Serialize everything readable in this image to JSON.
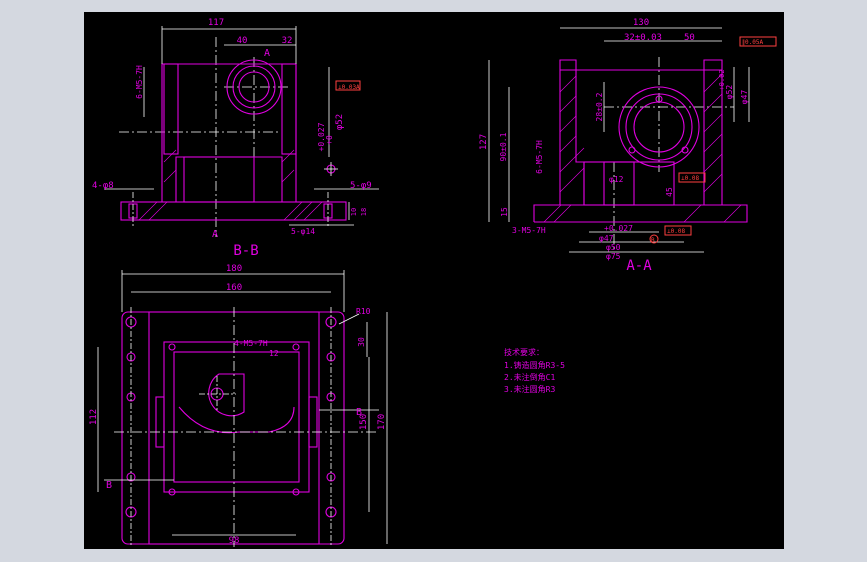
{
  "views": {
    "bb": {
      "title": "B-B",
      "dims": {
        "width_total": "117",
        "d40": "40",
        "d32": "32",
        "thread": "6-M5-7H",
        "bore_tol": "+0.027",
        "bore_tol2": "+0",
        "bore_dia": "φ52",
        "holes_left": "4-φ8",
        "holes_right": "5-φ9",
        "holes_bottom": "5-φ14",
        "h10": "10",
        "h18": "18",
        "flag": "⊥0.03A",
        "section_a": "A"
      }
    },
    "aa": {
      "title": "A-A",
      "dims": {
        "width_total": "130",
        "d32": "32±0.03",
        "d50": "50",
        "flag_top": "∥0.05A",
        "h127": "127",
        "h90": "90±0.1",
        "h28": "28±0.2",
        "thread": "6-M5-7H",
        "d12": "φ12",
        "flag_mid": "⊥0.08",
        "d45": "45",
        "h15": "15",
        "thread_bottom": "3-M5-7H",
        "bore_tol": "+0.027",
        "d47": "φ47",
        "d50b": "φ50",
        "d75": "φ75",
        "flag_bottom": "⊥0.08",
        "d47r": "φ47",
        "d52r": "φ52",
        "tol_r": "+0.02",
        "datum": "B"
      }
    },
    "top": {
      "dims": {
        "w180": "180",
        "w160": "160",
        "r10": "R10",
        "thread": "4-M5-7H",
        "d12": "12",
        "d30": "30",
        "h112": "112",
        "h150": "150",
        "h170": "170",
        "w98": "98",
        "sec_b_left": "B",
        "sec_b_right": "B"
      }
    }
  },
  "notes": {
    "title": "技术要求：",
    "items": [
      "1.铸造圆角R3-5",
      "2.未注倒角C1",
      "3.未注圆角R3"
    ]
  },
  "colors": {
    "line": "#e000e0",
    "center": "#ffffff",
    "annotation": "#ff4040",
    "background": "#000000"
  }
}
